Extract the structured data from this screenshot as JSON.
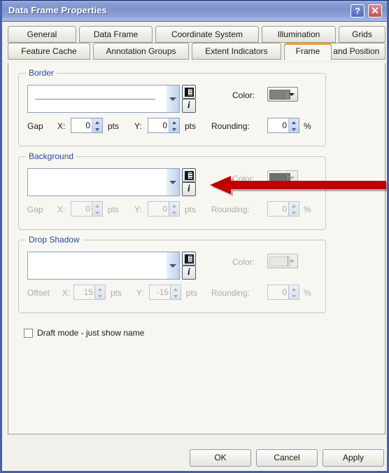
{
  "window": {
    "title": "Data Frame Properties",
    "help_button": "?",
    "close_button": "✕"
  },
  "tabs": {
    "row1": [
      {
        "label": "General",
        "selected": false
      },
      {
        "label": "Data Frame",
        "selected": false
      },
      {
        "label": "Coordinate System",
        "selected": false
      },
      {
        "label": "Illumination",
        "selected": false
      },
      {
        "label": "Grids",
        "selected": false
      }
    ],
    "row2": [
      {
        "label": "Feature Cache",
        "selected": false
      },
      {
        "label": "Annotation Groups",
        "selected": false
      },
      {
        "label": "Extent Indicators",
        "selected": false
      },
      {
        "label": "Frame",
        "selected": true
      },
      {
        "label": "Size and Position",
        "selected": false
      }
    ],
    "selected_tab": "Frame",
    "selected_accent_color": "#F0A030"
  },
  "border_group": {
    "label": "Border",
    "color_label": "Color:",
    "color_value": "#808080",
    "gap_label": "Gap",
    "x_label": "X:",
    "x_value": "0",
    "x_units": "pts",
    "y_label": "Y:",
    "y_value": "0",
    "y_units": "pts",
    "rounding_label": "Rounding:",
    "rounding_value": "0",
    "rounding_units": "%",
    "symbol_selector_icon": "symbol-list-icon",
    "style_ref_icon": "italic-i-icon",
    "enabled": true
  },
  "background_group": {
    "label": "Background",
    "color_label": "Color:",
    "color_value": "#6E6E6E",
    "gap_label": "Gap",
    "x_label": "X:",
    "x_value": "0",
    "x_units": "pts",
    "y_label": "Y:",
    "y_value": "0",
    "y_units": "pts",
    "rounding_label": "Rounding:",
    "rounding_value": "0",
    "rounding_units": "%",
    "symbol_selector_icon": "symbol-list-icon",
    "style_ref_icon": "italic-i-icon",
    "enabled": false
  },
  "dropshadow_group": {
    "label": "Drop Shadow",
    "color_label": "Color:",
    "color_value": "#E8E7E0",
    "offset_label": "Offset",
    "x_label": "X:",
    "x_value": "15",
    "x_units": "pts",
    "y_label": "Y:",
    "y_value": "-15",
    "y_units": "pts",
    "rounding_label": "Rounding:",
    "rounding_value": "0",
    "rounding_units": "%",
    "symbol_selector_icon": "symbol-list-icon",
    "style_ref_icon": "italic-i-icon",
    "enabled": false
  },
  "draft_mode": {
    "label": "Draft mode - just show name",
    "checked": false
  },
  "footer": {
    "ok_label": "OK",
    "cancel_label": "Cancel",
    "apply_label": "Apply"
  },
  "annotation": {
    "type": "arrow",
    "color": "#C00000",
    "direction": "left",
    "points_at": "background-color-swatch"
  }
}
